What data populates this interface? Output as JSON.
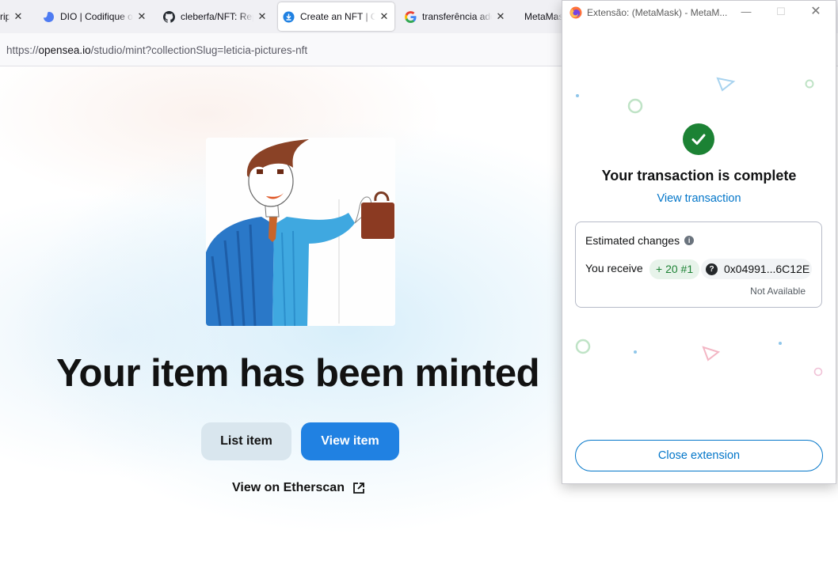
{
  "browser": {
    "tabs": [
      {
        "title": "ripti",
        "icon": "page-icon"
      },
      {
        "title": "DIO | Codifique o",
        "icon": "dio-icon"
      },
      {
        "title": "cleberfa/NFT: Rep",
        "icon": "github-icon"
      },
      {
        "title": "Create an NFT | O|",
        "icon": "opensea-icon",
        "active": true
      },
      {
        "title": "transferência add",
        "icon": "google-icon"
      },
      {
        "title": "MetaMas",
        "icon": "metamask-icon"
      }
    ],
    "url": {
      "scheme": "https://",
      "host": "opensea.io",
      "path": "/studio/mint?collectionSlug=leticia-pictures-nft"
    }
  },
  "page": {
    "artwork_alt": "drawing",
    "headline": "Your item has been minted",
    "list_button": "List item",
    "view_button": "View item",
    "etherscan_link": "View on Etherscan"
  },
  "popup": {
    "window_title": "Extensão: (MetaMask) - MetaM...",
    "status": "Your transaction is complete",
    "view_transaction": "View transaction",
    "estimated_changes": "Estimated changes",
    "you_receive": "You receive",
    "amount": "+ 20 #1",
    "address": "0x04991...6C12E",
    "fiat": "Not Available",
    "close_button": "Close extension"
  },
  "colors": {
    "opensea_blue": "#2081e2",
    "metamask_blue": "#0376c9",
    "success_green": "#1c8234"
  }
}
